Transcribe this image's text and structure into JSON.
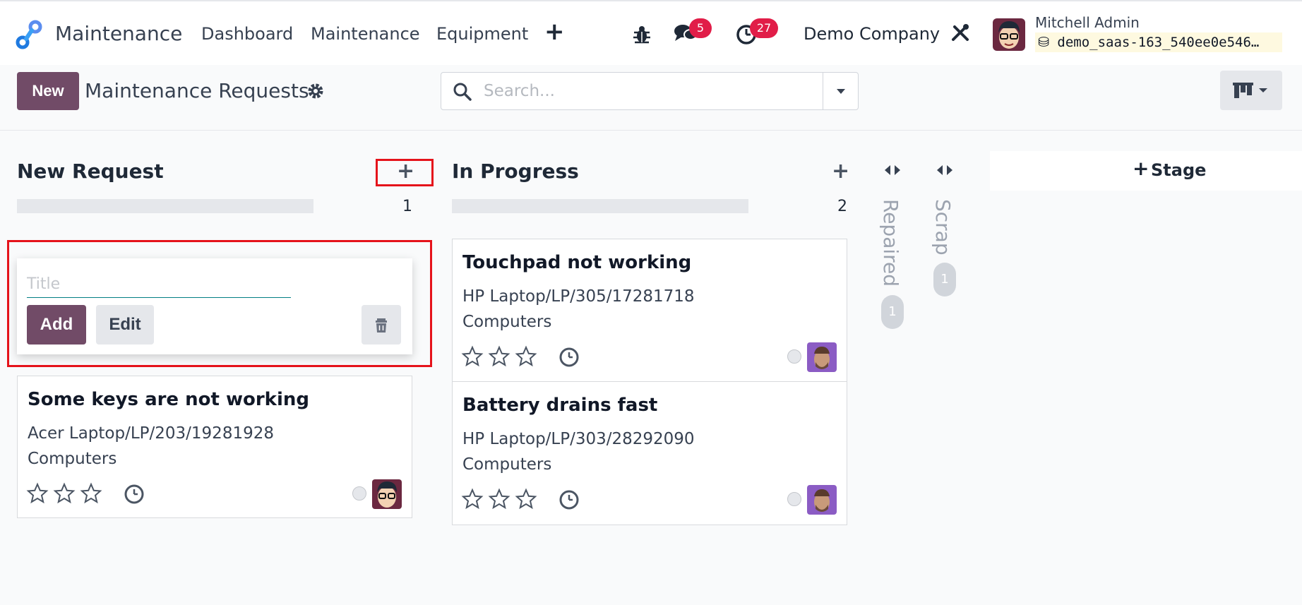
{
  "navbar": {
    "app_name": "Maintenance",
    "links": [
      "Dashboard",
      "Maintenance",
      "Equipment"
    ],
    "messages_count": "5",
    "activities_count": "27",
    "company": "Demo Company",
    "user_name": "Mitchell Admin",
    "database": "demo_saas-163_540ee0e546…"
  },
  "control_panel": {
    "new_label": "New",
    "title": "Maintenance Requests",
    "search_placeholder": "Search..."
  },
  "columns": [
    {
      "title": "New Request",
      "count": "1",
      "quick_create": {
        "title_placeholder": "Title",
        "add_label": "Add",
        "edit_label": "Edit"
      },
      "cards": [
        {
          "title": "Some keys are not working",
          "equipment": "Acer Laptop/LP/203/19281928",
          "category": "Computers",
          "priority_stars": 0
        }
      ]
    },
    {
      "title": "In Progress",
      "count": "2",
      "cards": [
        {
          "title": "Touchpad not working",
          "equipment": "HP Laptop/LP/305/17281718",
          "category": "Computers",
          "priority_stars": 0
        },
        {
          "title": "Battery drains fast",
          "equipment": "HP Laptop/LP/303/28292090",
          "category": "Computers",
          "priority_stars": 0
        }
      ]
    }
  ],
  "folded_columns": [
    {
      "title": "Repaired",
      "count": "1"
    },
    {
      "title": "Scrap",
      "count": "1"
    }
  ],
  "add_stage_label": "Stage",
  "colors": {
    "brand": "#714b67",
    "badge": "#e11d48",
    "highlight": "#e5131b"
  }
}
